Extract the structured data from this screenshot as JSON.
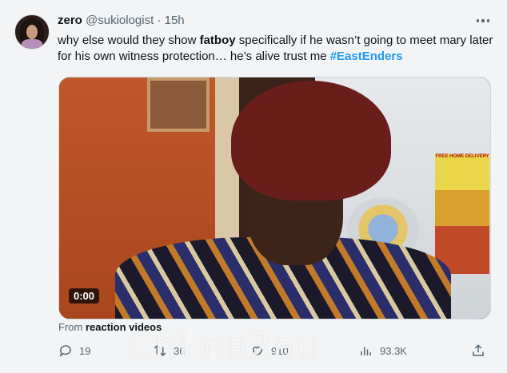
{
  "tweet": {
    "author_name": "zero",
    "author_handle": "@sukiologist",
    "separator": "·",
    "time": "15h",
    "text_part1": "why else would they show ",
    "text_bold": "fatboy",
    "text_part2": " specifically if he wasn’t going to meet mary later for his own witness protection… he’s alive trust me ",
    "hashtag": "#EastEnders",
    "video_timestamp": "0:00",
    "attribution_prefix": "From ",
    "attribution_source": "reaction videos",
    "video_flyer_text": "FREE HOME DELIVERY"
  },
  "actions": {
    "replies": "19",
    "reposts": "36",
    "likes": "910",
    "views": "93.3K"
  },
  "watermark": "Chi na2au",
  "colors": {
    "background": "#f3f4f5",
    "text": "#0f1419",
    "muted": "#536471",
    "hashtag": "#1d9bf0"
  },
  "icons": [
    "more-icon",
    "reply-icon",
    "repost-icon",
    "like-icon",
    "views-icon",
    "share-icon"
  ]
}
